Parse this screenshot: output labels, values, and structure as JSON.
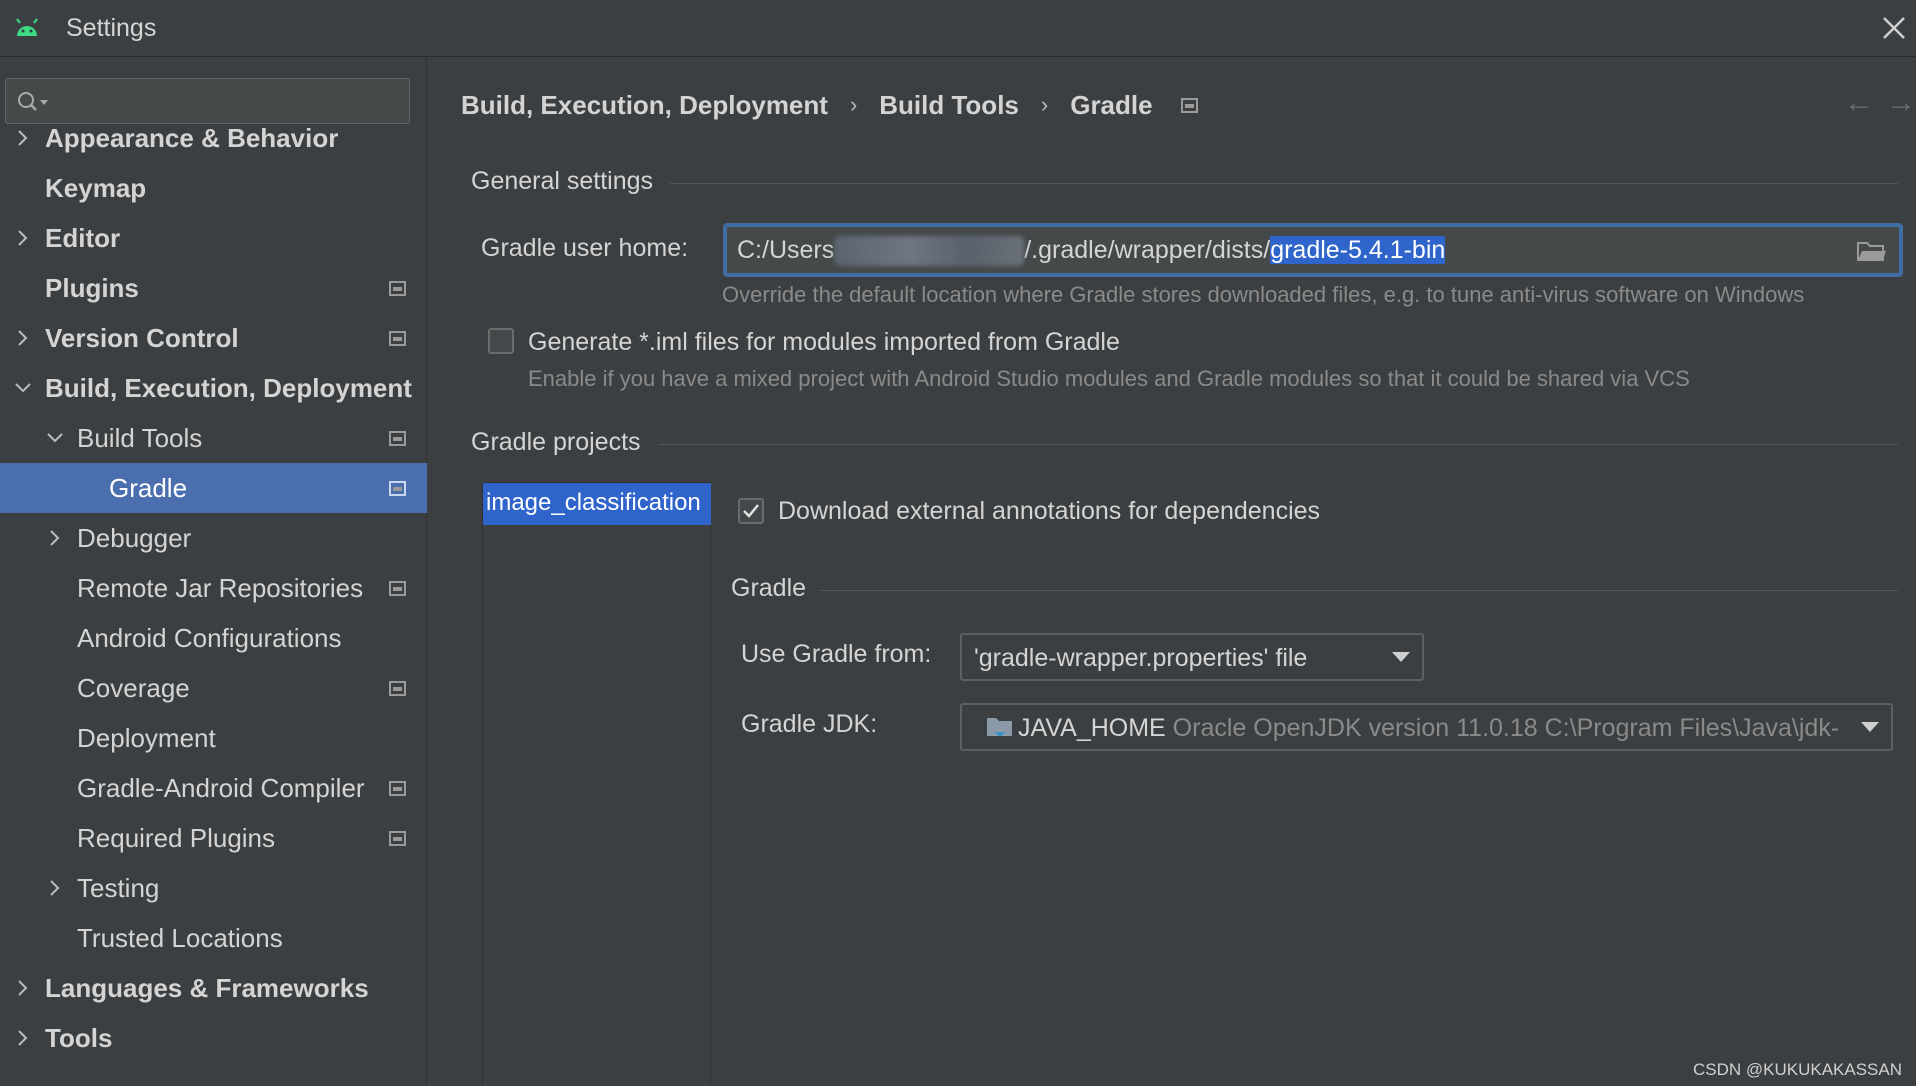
{
  "window": {
    "title": "Settings"
  },
  "sidebar": {
    "search_placeholder": "",
    "items": [
      {
        "label": "Appearance & Behavior"
      },
      {
        "label": "Keymap"
      },
      {
        "label": "Editor"
      },
      {
        "label": "Plugins"
      },
      {
        "label": "Version Control"
      },
      {
        "label": "Build, Execution, Deployment"
      },
      {
        "label": "Build Tools"
      },
      {
        "label": "Gradle"
      },
      {
        "label": "Debugger"
      },
      {
        "label": "Remote Jar Repositories"
      },
      {
        "label": "Android Configurations"
      },
      {
        "label": "Coverage"
      },
      {
        "label": "Deployment"
      },
      {
        "label": "Gradle-Android Compiler"
      },
      {
        "label": "Required Plugins"
      },
      {
        "label": "Testing"
      },
      {
        "label": "Trusted Locations"
      },
      {
        "label": "Languages & Frameworks"
      },
      {
        "label": "Tools"
      }
    ]
  },
  "breadcrumb": {
    "items": [
      "Build, Execution, Deployment",
      "Build Tools",
      "Gradle"
    ],
    "separator": "›"
  },
  "general": {
    "title": "General settings",
    "user_home_label": "Gradle user home:",
    "user_home_prefix": "C:/Users",
    "user_home_middle": "/.gradle/wrapper/dists/",
    "user_home_selected": "gradle-5.4.1-bin",
    "user_home_hint": "Override the default location where Gradle stores downloaded files, e.g. to tune anti-virus software on Windows",
    "iml_label": "Generate *.iml files for modules imported from Gradle",
    "iml_checked": false,
    "iml_hint": "Enable if you have a mixed project with Android Studio modules and Gradle modules so that it could be shared via VCS"
  },
  "projects": {
    "title": "Gradle projects",
    "items": [
      "image_classification"
    ],
    "download_annotations_label": "Download external annotations for dependencies",
    "download_annotations_checked": true,
    "gradle_section_title": "Gradle",
    "use_gradle_from_label": "Use Gradle from:",
    "use_gradle_from_value": "'gradle-wrapper.properties' file",
    "jdk_label": "Gradle JDK:",
    "jdk_name": "JAVA_HOME",
    "jdk_detail": "Oracle OpenJDK version 11.0.18 C:\\Program Files\\Java\\jdk-"
  },
  "watermark": "CSDN @KUKUKAKASSAN",
  "colors": {
    "background": "#3c3f41",
    "selection": "#4b6eaf",
    "text_selection": "#2f65ca",
    "android_green": "#3ddc84"
  }
}
